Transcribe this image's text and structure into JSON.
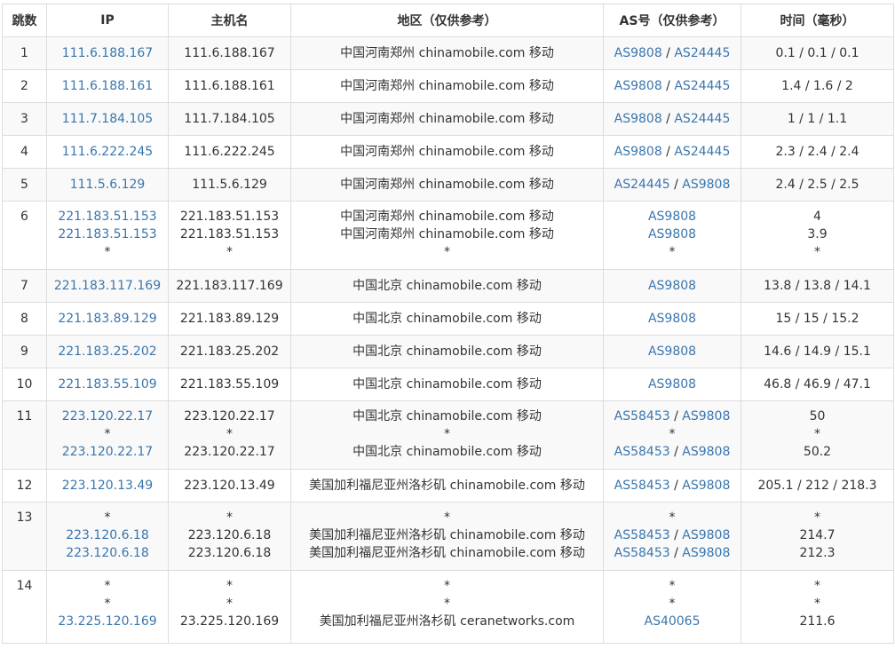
{
  "headers": [
    "跳数",
    "IP",
    "主机名",
    "地区（仅供参考）",
    "AS号（仅供参考）",
    "时间（毫秒）"
  ],
  "rows": [
    {
      "hop": "1",
      "lines": [
        {
          "ip": "111.6.188.167",
          "host": "111.6.188.167",
          "region": "中国河南郑州 chinamobile.com 移动",
          "as": [
            "AS9808",
            "AS24445"
          ],
          "time": "0.1 / 0.1 / 0.1"
        }
      ]
    },
    {
      "hop": "2",
      "lines": [
        {
          "ip": "111.6.188.161",
          "host": "111.6.188.161",
          "region": "中国河南郑州 chinamobile.com 移动",
          "as": [
            "AS9808",
            "AS24445"
          ],
          "time": "1.4 / 1.6 / 2"
        }
      ]
    },
    {
      "hop": "3",
      "lines": [
        {
          "ip": "111.7.184.105",
          "host": "111.7.184.105",
          "region": "中国河南郑州 chinamobile.com 移动",
          "as": [
            "AS9808",
            "AS24445"
          ],
          "time": "1 / 1 / 1.1"
        }
      ]
    },
    {
      "hop": "4",
      "lines": [
        {
          "ip": "111.6.222.245",
          "host": "111.6.222.245",
          "region": "中国河南郑州 chinamobile.com 移动",
          "as": [
            "AS9808",
            "AS24445"
          ],
          "time": "2.3 / 2.4 / 2.4"
        }
      ]
    },
    {
      "hop": "5",
      "lines": [
        {
          "ip": "111.5.6.129",
          "host": "111.5.6.129",
          "region": "中国河南郑州 chinamobile.com 移动",
          "as": [
            "AS24445",
            "AS9808"
          ],
          "time": "2.4 / 2.5 / 2.5"
        }
      ]
    },
    {
      "hop": "6",
      "lines": [
        {
          "ip": "221.183.51.153",
          "host": "221.183.51.153",
          "region": "中国河南郑州 chinamobile.com 移动",
          "as": [
            "AS9808"
          ],
          "time": "4"
        },
        {
          "ip": "221.183.51.153",
          "host": "221.183.51.153",
          "region": "中国河南郑州 chinamobile.com 移动",
          "as": [
            "AS9808"
          ],
          "time": "3.9"
        },
        {
          "ip": "*",
          "host": "*",
          "region": "*",
          "as": [
            "*"
          ],
          "time": "*"
        }
      ]
    },
    {
      "hop": "7",
      "lines": [
        {
          "ip": "221.183.117.169",
          "host": "221.183.117.169",
          "region": "中国北京 chinamobile.com 移动",
          "as": [
            "AS9808"
          ],
          "time": "13.8 / 13.8 / 14.1"
        }
      ]
    },
    {
      "hop": "8",
      "lines": [
        {
          "ip": "221.183.89.129",
          "host": "221.183.89.129",
          "region": "中国北京 chinamobile.com 移动",
          "as": [
            "AS9808"
          ],
          "time": "15 / 15 / 15.2"
        }
      ]
    },
    {
      "hop": "9",
      "lines": [
        {
          "ip": "221.183.25.202",
          "host": "221.183.25.202",
          "region": "中国北京 chinamobile.com 移动",
          "as": [
            "AS9808"
          ],
          "time": "14.6 / 14.9 / 15.1"
        }
      ]
    },
    {
      "hop": "10",
      "lines": [
        {
          "ip": "221.183.55.109",
          "host": "221.183.55.109",
          "region": "中国北京 chinamobile.com 移动",
          "as": [
            "AS9808"
          ],
          "time": "46.8 / 46.9 / 47.1"
        }
      ]
    },
    {
      "hop": "11",
      "lines": [
        {
          "ip": "223.120.22.17",
          "host": "223.120.22.17",
          "region": "中国北京 chinamobile.com 移动",
          "as": [
            "AS58453",
            "AS9808"
          ],
          "time": "50"
        },
        {
          "ip": "*",
          "host": "*",
          "region": "*",
          "as": [
            "*"
          ],
          "time": "*"
        },
        {
          "ip": "223.120.22.17",
          "host": "223.120.22.17",
          "region": "中国北京 chinamobile.com 移动",
          "as": [
            "AS58453",
            "AS9808"
          ],
          "time": "50.2"
        }
      ]
    },
    {
      "hop": "12",
      "lines": [
        {
          "ip": "223.120.13.49",
          "host": "223.120.13.49",
          "region": "美国加利福尼亚州洛杉矶 chinamobile.com 移动",
          "as": [
            "AS58453",
            "AS9808"
          ],
          "time": "205.1 / 212 / 218.3"
        }
      ]
    },
    {
      "hop": "13",
      "lines": [
        {
          "ip": "*",
          "host": "*",
          "region": "*",
          "as": [
            "*"
          ],
          "time": "*"
        },
        {
          "ip": "223.120.6.18",
          "host": "223.120.6.18",
          "region": "美国加利福尼亚州洛杉矶 chinamobile.com 移动",
          "as": [
            "AS58453",
            "AS9808"
          ],
          "time": "214.7"
        },
        {
          "ip": "223.120.6.18",
          "host": "223.120.6.18",
          "region": "美国加利福尼亚州洛杉矶 chinamobile.com 移动",
          "as": [
            "AS58453",
            "AS9808"
          ],
          "time": "212.3"
        }
      ]
    },
    {
      "hop": "14",
      "lines": [
        {
          "ip": "*",
          "host": "*",
          "region": "*",
          "as": [
            "*"
          ],
          "time": "*"
        },
        {
          "ip": "*",
          "host": "*",
          "region": "*",
          "as": [
            "*"
          ],
          "time": "*"
        },
        {
          "ip": "23.225.120.169",
          "host": "23.225.120.169",
          "region": "美国加利福尼亚州洛杉矶 ceranetworks.com",
          "as": [
            "AS40065"
          ],
          "time": "211.6"
        }
      ]
    }
  ]
}
